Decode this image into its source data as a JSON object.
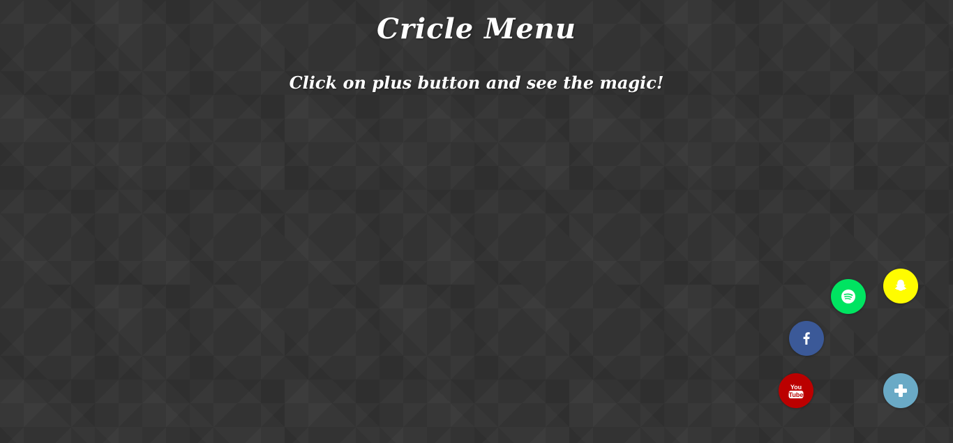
{
  "header": {
    "title": "Cricle Menu",
    "subtitle": "Click on plus button and see the magic!"
  },
  "menu": {
    "items": [
      {
        "name": "snapchat",
        "icon": "snapchat-icon",
        "color": "#fffc00"
      },
      {
        "name": "spotify",
        "icon": "spotify-icon",
        "color": "#00e461"
      },
      {
        "name": "facebook",
        "icon": "facebook-icon",
        "color": "#3b5998"
      },
      {
        "name": "youtube",
        "icon": "youtube-icon",
        "color": "#bb0000",
        "icon_text_top": "You",
        "icon_text_bottom": "Tube"
      }
    ],
    "toggle": {
      "icon": "plus-icon",
      "color": "#6aaac6"
    }
  },
  "colors": {
    "background": "#333333",
    "text": "#ffffff"
  }
}
